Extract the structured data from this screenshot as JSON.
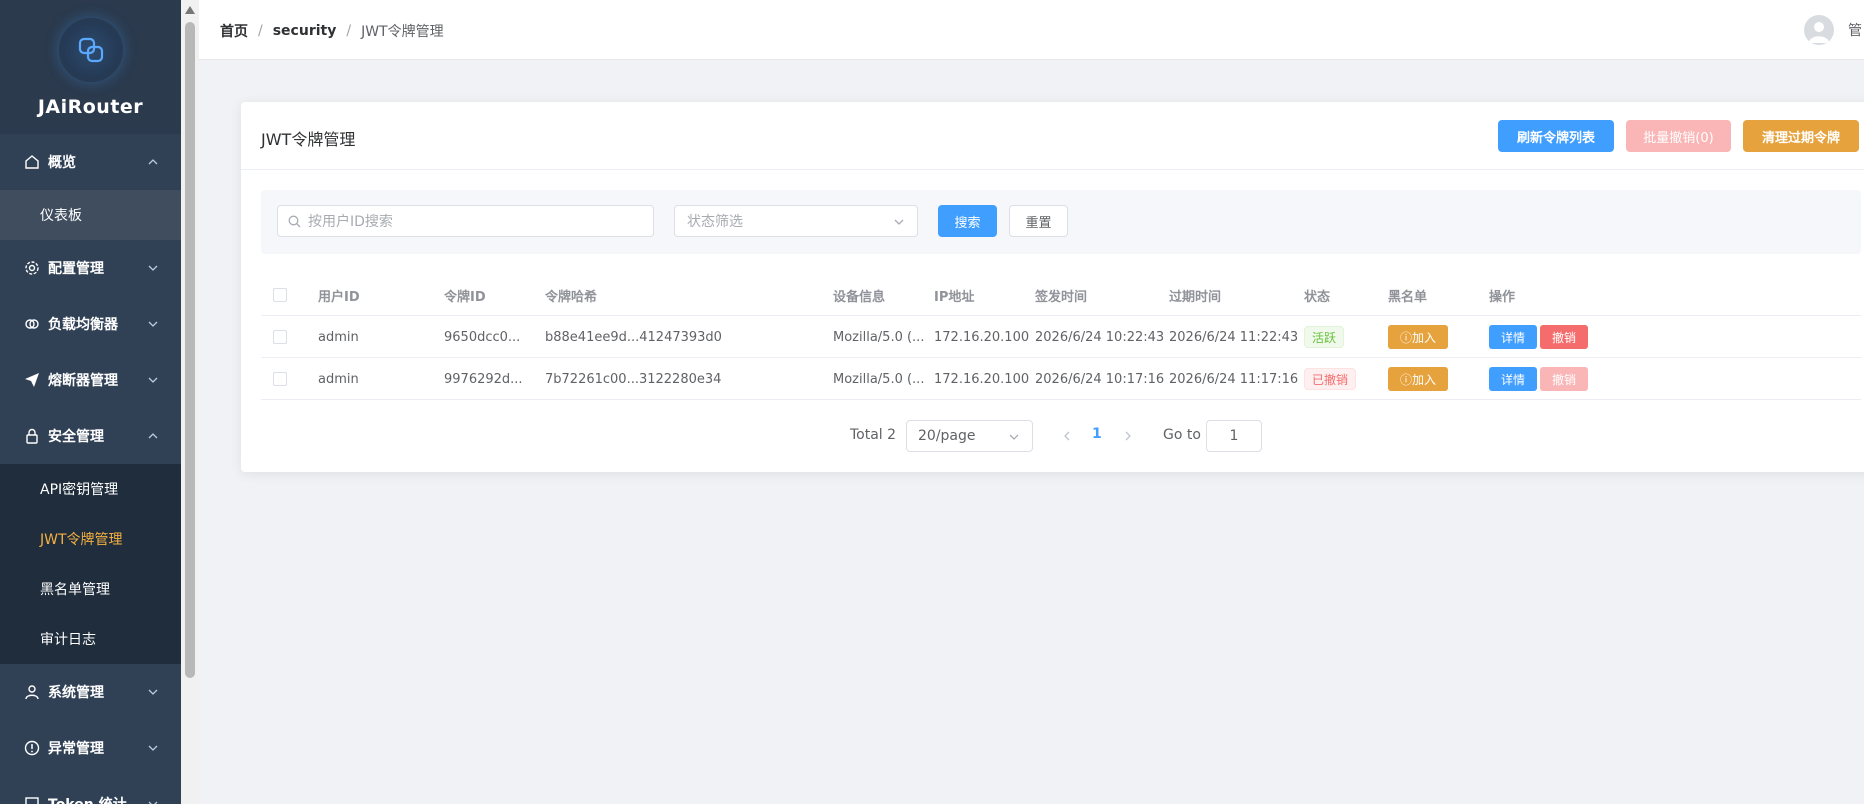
{
  "app": {
    "name": "JAiRouter"
  },
  "sidebar": {
    "items": [
      {
        "label": "概览",
        "icon": "home-icon",
        "expanded": true,
        "children": [
          {
            "label": "仪表板"
          }
        ]
      },
      {
        "label": "配置管理",
        "icon": "gear-icon",
        "expanded": false
      },
      {
        "label": "负载均衡器",
        "icon": "link-icon",
        "expanded": false
      },
      {
        "label": "熔断器管理",
        "icon": "paper-plane-icon",
        "expanded": false
      },
      {
        "label": "安全管理",
        "icon": "lock-icon",
        "expanded": true,
        "children": [
          {
            "label": "API密钥管理"
          },
          {
            "label": "JWT令牌管理",
            "active": true
          },
          {
            "label": "黑名单管理"
          },
          {
            "label": "审计日志"
          }
        ]
      },
      {
        "label": "系统管理",
        "icon": "user-icon",
        "expanded": false
      },
      {
        "label": "异常管理",
        "icon": "alert-circle-icon",
        "expanded": false
      },
      {
        "label": "Token 统计",
        "icon": "chart-icon",
        "expanded": false
      }
    ]
  },
  "header": {
    "breadcrumb": [
      "首页",
      "security",
      "JWT令牌管理"
    ],
    "user_name": "管"
  },
  "page": {
    "title": "JWT令牌管理",
    "buttons": {
      "refresh": "刷新令牌列表",
      "batch_revoke": "批量撤销(0)",
      "clean_expired": "清理过期令牌"
    }
  },
  "filters": {
    "search_placeholder": "按用户ID搜索",
    "status_placeholder": "状态筛选",
    "search_button": "搜索",
    "reset_button": "重置"
  },
  "table": {
    "columns": [
      "用户ID",
      "令牌ID",
      "令牌哈希",
      "设备信息",
      "IP地址",
      "签发时间",
      "过期时间",
      "状态",
      "黑名单",
      "操作"
    ],
    "rows": [
      {
        "user_id": "admin",
        "token_id": "9650dcc0...",
        "token_hash": "b88e41ee9d...41247393d0",
        "device": "Mozilla/5.0 (...",
        "ip": "172.16.20.100",
        "issued": "2026/6/24 10:22:43",
        "expires": "2026/6/24 11:22:43",
        "status": "活跃",
        "blacklist_action": "ⓘ加入",
        "detail_action": "详情",
        "revoke_action": "撤销"
      },
      {
        "user_id": "admin",
        "token_id": "9976292d...",
        "token_hash": "7b72261c00...3122280e34",
        "device": "Mozilla/5.0 (...",
        "ip": "172.16.20.100",
        "issued": "2026/6/24 10:17:16",
        "expires": "2026/6/24 11:17:16",
        "status": "已撤销",
        "blacklist_action": "ⓘ加入",
        "detail_action": "详情",
        "revoke_action": "撤销"
      }
    ]
  },
  "pagination": {
    "total": "Total 2",
    "page_size": "20/page",
    "current": "1",
    "goto_label": "Go to",
    "goto_value": "1"
  },
  "colors": {
    "sidebar_bg": "#304156",
    "submenu_bg": "#1f2d3d",
    "active_submenu": "#f5b041",
    "primary": "#409eff",
    "warning": "#e6a23c",
    "danger": "#f56c6c",
    "success": "#67c23a"
  }
}
